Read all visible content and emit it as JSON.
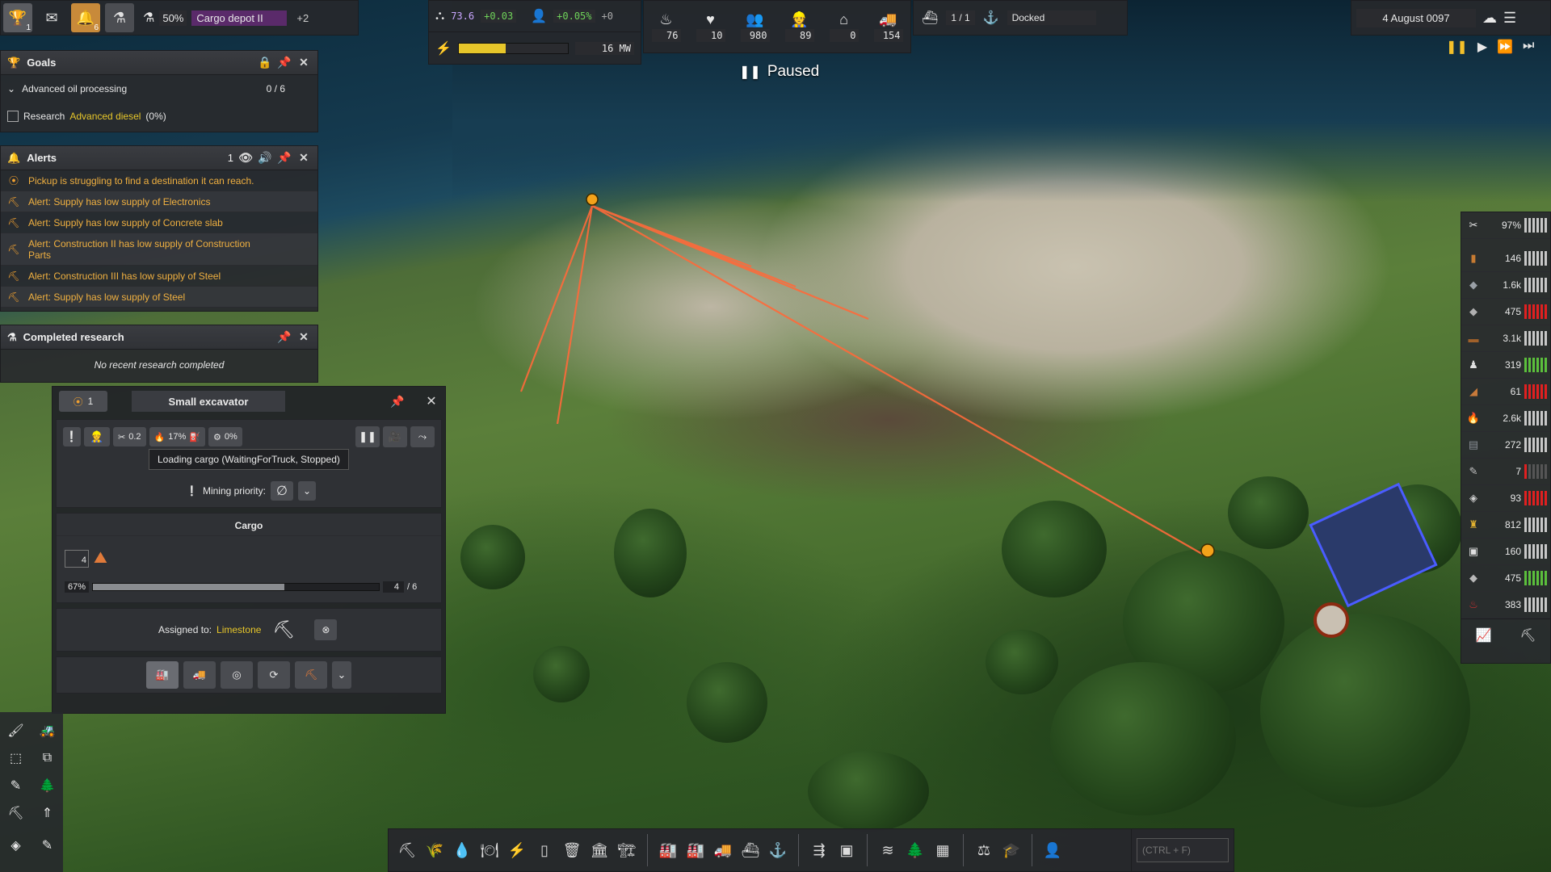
{
  "topbar": {
    "trophy_count": "1",
    "alerts_count": "6",
    "storage_percent": "50%",
    "storage_name": "Cargo depot II",
    "storage_more": "+2",
    "unity_value": "73.6",
    "unity_delta": "+0.03",
    "pop_growth": "+0.05%",
    "pop_delta": "+0",
    "power_value": "16 MW",
    "power_fill": 0.43,
    "stats": [
      "76",
      "10",
      "980",
      "89",
      "0",
      "154"
    ],
    "ships": "1 / 1",
    "ship_status": "Docked",
    "date": "4 August 0097",
    "paused_label": "Paused"
  },
  "goals": {
    "title": "Goals",
    "goal_name": "Advanced oil processing",
    "goal_progress": "0 / 6",
    "task_prefix": "Research",
    "task_link": "Advanced diesel",
    "task_suffix": "(0%)"
  },
  "alerts": {
    "title": "Alerts",
    "count": "1",
    "items": [
      "Pickup is struggling to find a destination it can reach.",
      "Alert: Supply has low supply of Electronics",
      "Alert: Supply has low supply of Concrete slab",
      "Alert: Construction II has low supply of Construction Parts",
      "Alert: Construction III has low supply of Steel",
      "Alert: Supply has low supply of Steel"
    ]
  },
  "research": {
    "title": "Completed research",
    "empty": "No recent research completed"
  },
  "inspector": {
    "badge": "1",
    "title": "Small excavator",
    "stat_work": "0.2",
    "stat_fuel": "17%",
    "stat_maint": "0%",
    "status": "Loading cargo (WaitingForTruck, Stopped)",
    "mining_priority_label": "Mining priority:",
    "cargo_title": "Cargo",
    "cargo_qty": "4",
    "cargo_percent": "67%",
    "cargo_fill": 0.67,
    "cargo_count": "4",
    "cargo_capacity": "/ 6",
    "assigned_label": "Assigned to:",
    "assigned_to": "Limestone"
  },
  "resources": [
    {
      "icon": "✂",
      "value": "97%",
      "bars": "white"
    },
    {
      "icon": "▮",
      "value": "146",
      "bars": "white",
      "color": "#c67b32"
    },
    {
      "icon": "◆",
      "value": "1.6k",
      "bars": "white",
      "color": "#9aa0a6"
    },
    {
      "icon": "◆",
      "value": "475",
      "bars": "red",
      "color": "#b0b0b0"
    },
    {
      "icon": "▬",
      "value": "3.1k",
      "bars": "white",
      "color": "#a0612a"
    },
    {
      "icon": "♟",
      "value": "319",
      "bars": "green",
      "color": "#e0e0e0"
    },
    {
      "icon": "◢",
      "value": "61",
      "bars": "red",
      "color": "#c87a3a"
    },
    {
      "icon": "🔥",
      "value": "2.6k",
      "bars": "white",
      "color": "#e24020"
    },
    {
      "icon": "▤",
      "value": "272",
      "bars": "white",
      "color": "#8a8f96"
    },
    {
      "icon": "✎",
      "value": "7",
      "bars": "redlow",
      "color": "#c0c0c0"
    },
    {
      "icon": "◈",
      "value": "93",
      "bars": "red",
      "color": "#d0d0d0"
    },
    {
      "icon": "♜",
      "value": "812",
      "bars": "white",
      "color": "#e0b030"
    },
    {
      "icon": "▣",
      "value": "160",
      "bars": "white",
      "color": "#e0e0e0"
    },
    {
      "icon": "◆",
      "value": "475",
      "bars": "green",
      "color": "#b8b8b8"
    },
    {
      "icon": "♨",
      "value": "383",
      "bars": "white",
      "color": "#d03030"
    }
  ],
  "bottombar": {
    "search_placeholder": "(CTRL + F)"
  }
}
